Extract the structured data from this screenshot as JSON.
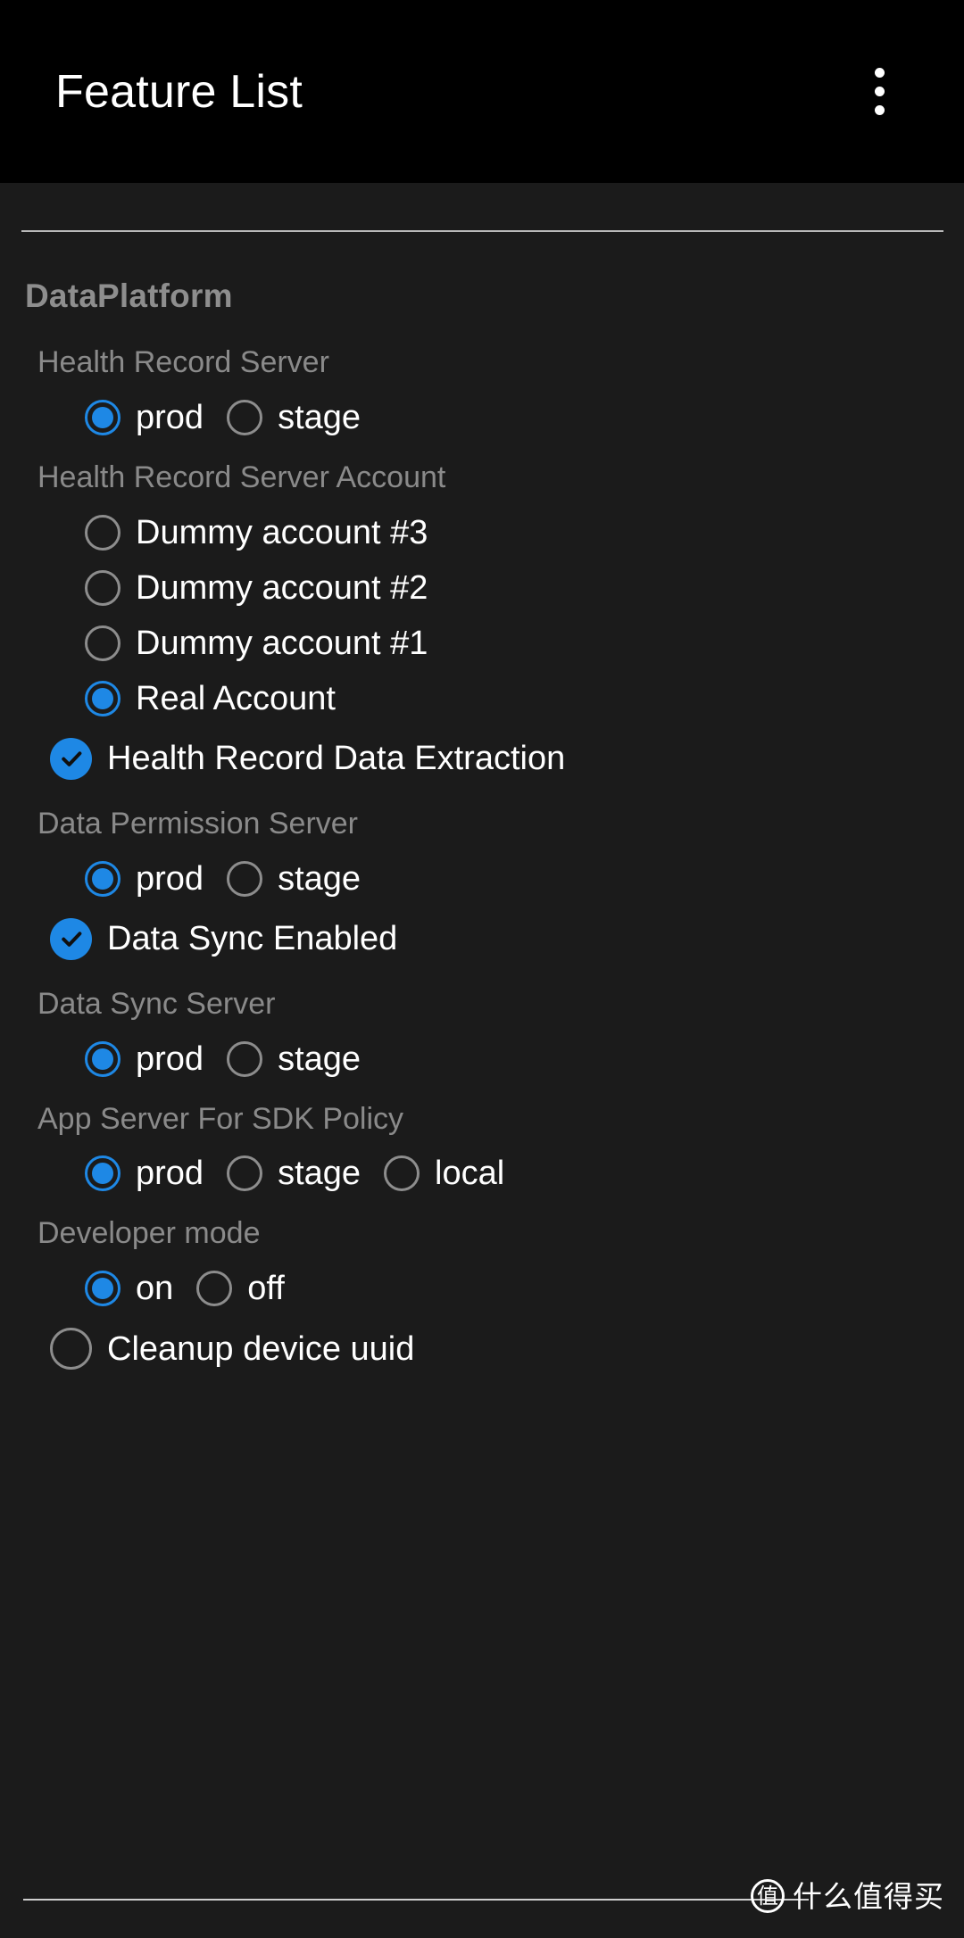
{
  "appbar": {
    "title": "Feature List",
    "overflow_menu_label": "More options"
  },
  "colors": {
    "accent": "#1e88e5",
    "background": "#1b1b1b",
    "appbar_background": "#000000",
    "primary_text": "#ffffff",
    "secondary_text": "#8a8a8a",
    "unchecked_outline": "#8d8d8d"
  },
  "content": {
    "group_title": "DataPlatform",
    "items": [
      {
        "kind": "radio_group",
        "title": "Health Record Server",
        "layout": "inline",
        "options": [
          {
            "label": "prod",
            "selected": true
          },
          {
            "label": "stage",
            "selected": false
          }
        ]
      },
      {
        "kind": "radio_group",
        "title": "Health Record Server Account",
        "layout": "stacked",
        "options": [
          {
            "label": "Dummy account #3",
            "selected": false
          },
          {
            "label": "Dummy account #2",
            "selected": false
          },
          {
            "label": "Dummy account #1",
            "selected": false
          },
          {
            "label": "Real Account",
            "selected": true
          }
        ]
      },
      {
        "kind": "checkbox",
        "label": "Health Record Data Extraction",
        "checked": true
      },
      {
        "kind": "radio_group",
        "title": "Data Permission Server",
        "layout": "inline",
        "options": [
          {
            "label": "prod",
            "selected": true
          },
          {
            "label": "stage",
            "selected": false
          }
        ]
      },
      {
        "kind": "checkbox",
        "label": "Data Sync Enabled",
        "checked": true
      },
      {
        "kind": "radio_group",
        "title": "Data Sync Server",
        "layout": "inline",
        "options": [
          {
            "label": "prod",
            "selected": true
          },
          {
            "label": "stage",
            "selected": false
          }
        ]
      },
      {
        "kind": "radio_group",
        "title": "App Server For SDK Policy",
        "layout": "inline",
        "options": [
          {
            "label": "prod",
            "selected": true
          },
          {
            "label": "stage",
            "selected": false
          },
          {
            "label": "local",
            "selected": false
          }
        ]
      },
      {
        "kind": "radio_group",
        "title": "Developer mode",
        "layout": "inline",
        "options": [
          {
            "label": "on",
            "selected": true
          },
          {
            "label": "off",
            "selected": false
          }
        ]
      },
      {
        "kind": "checkbox",
        "label": "Cleanup device uuid",
        "checked": false
      }
    ]
  },
  "watermark": {
    "logo_glyph": "值",
    "text": "什么值得买"
  }
}
